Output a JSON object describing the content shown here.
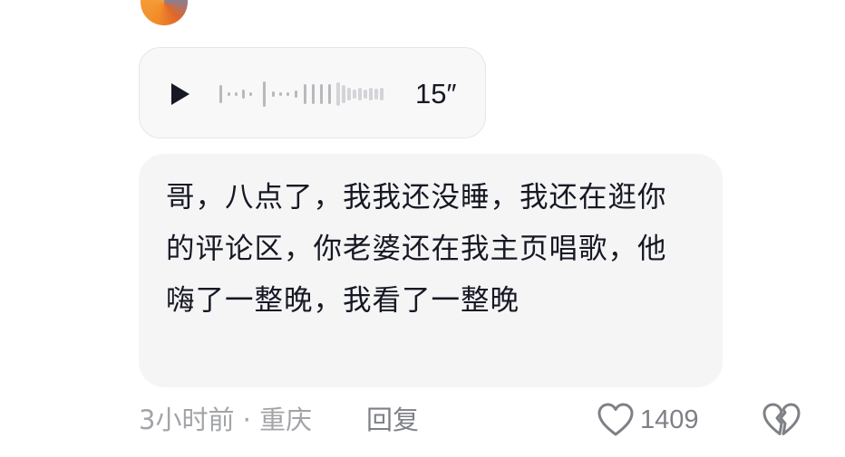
{
  "voice_message": {
    "duration": "15″"
  },
  "comment": {
    "text": "哥，八点了，我我还没睡，我还在逛你的评论区，你老婆还在我主页唱歌，他嗨了一整晚，我看了一整晚"
  },
  "meta": {
    "time_location": "3小时前 · 重庆",
    "reply_label": "回复",
    "like_count": "1409"
  },
  "icons": {
    "play": "play-icon",
    "like": "heart-outline-icon",
    "dislike": "broken-heart-icon"
  },
  "colors": {
    "text": "#161823",
    "meta_text": "#a3a4a8",
    "action_text": "#7e8086",
    "bubble_bg": "#f5f5f6"
  }
}
